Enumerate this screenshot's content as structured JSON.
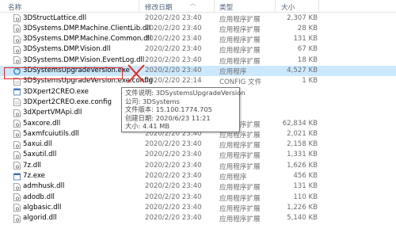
{
  "header": {
    "name": "名称",
    "date": "修改日期",
    "type": "类型",
    "size": "大小"
  },
  "rows": [
    {
      "name": "3DStructLattice.dll",
      "date": "2020/2/20 23:40",
      "type": "应用程序扩展",
      "size": "2,307 KB",
      "icon": "dll-icon"
    },
    {
      "name": "3DSystems.DMP.Machine.ClientLib.dll",
      "date": "2020/2/20 23:40",
      "type": "应用程序扩展",
      "size": "28 KB",
      "icon": "dll-icon"
    },
    {
      "name": "3DSystems.DMP.Machine.Common.dll",
      "date": "2020/2/20 23:40",
      "type": "应用程序扩展",
      "size": "131 KB",
      "icon": "dll-icon"
    },
    {
      "name": "3DSystems.DMP.Vision.dll",
      "date": "2020/2/20 23:40",
      "type": "应用程序扩展",
      "size": "67 KB",
      "icon": "dll-icon"
    },
    {
      "name": "3DSystems.DMP.Vision.EventLog.dll",
      "date": "2020/2/20 23:40",
      "type": "应用程序扩展",
      "size": "18 KB",
      "icon": "dll-icon"
    },
    {
      "name": "3DSystemsUpgradeVersion.exe",
      "date": "2020/2/20 23:40",
      "type": "应用程序",
      "size": "4,527 KB",
      "icon": "exe-3d-icon"
    },
    {
      "name": "3DSystemsUpgradeVersion.exe.config",
      "date": "2020/2/20 22:14",
      "type": "CONFIG 文件",
      "size": "1 KB",
      "icon": "config-icon"
    },
    {
      "name": "3DXpert2CREO.exe",
      "date": "",
      "type": "",
      "size": "",
      "icon": "exe-icon"
    },
    {
      "name": "3DXpert2CREO.exe.config",
      "date": "",
      "type": "",
      "size": "",
      "icon": "config-icon"
    },
    {
      "name": "3dXpertVMApi.dll",
      "date": "",
      "type": "",
      "size": "",
      "icon": "dll-icon"
    },
    {
      "name": "5axcore.dll",
      "date": "2020/2/20 23:40",
      "type": "应用程序扩展",
      "size": "62,834 KB",
      "icon": "dll-icon"
    },
    {
      "name": "5axmfcuiutils.dll",
      "date": "2020/2/20 23:40",
      "type": "应用程序扩展",
      "size": "2,021 KB",
      "icon": "dll-icon"
    },
    {
      "name": "5axui.dll",
      "date": "2020/2/20 23:40",
      "type": "应用程序扩展",
      "size": "2,158 KB",
      "icon": "dll-icon"
    },
    {
      "name": "5axutil.dll",
      "date": "2020/2/20 23:40",
      "type": "应用程序扩展",
      "size": "1,331 KB",
      "icon": "dll-icon"
    },
    {
      "name": "7z.dll",
      "date": "2020/2/20 23:40",
      "type": "应用程序扩展",
      "size": "1,626 KB",
      "icon": "dll-icon"
    },
    {
      "name": "7z.exe",
      "date": "2020/2/20 23:40",
      "type": "应用程序",
      "size": "456 KB",
      "icon": "exe-icon"
    },
    {
      "name": "admhusk.dll",
      "date": "2020/2/20 23:40",
      "type": "应用程序扩展",
      "size": "131 KB",
      "icon": "dll-icon"
    },
    {
      "name": "adodb.dll",
      "date": "2020/2/20 23:40",
      "type": "应用程序扩展",
      "size": "110 KB",
      "icon": "dll-icon"
    },
    {
      "name": "algbasic.dll",
      "date": "2020/2/20 23:40",
      "type": "应用程序扩展",
      "size": "1,226 KB",
      "icon": "dll-icon"
    },
    {
      "name": "algorid.dll",
      "date": "2020/2/20 23:40",
      "type": "应用程序扩展",
      "size": "5,140 KB",
      "icon": "dll-icon"
    }
  ],
  "tooltip": {
    "desc": "文件说明: 3DSystemsUpgradeVersion",
    "company": "公司: 3DSystems",
    "version": "文件版本: 15.100.1774.705",
    "created": "创建日期: 2020/6/23 11:21",
    "size": "大小: 4.41 MB"
  },
  "colors": {
    "selection": "#cce8ff",
    "annotation": "#e8231f"
  }
}
